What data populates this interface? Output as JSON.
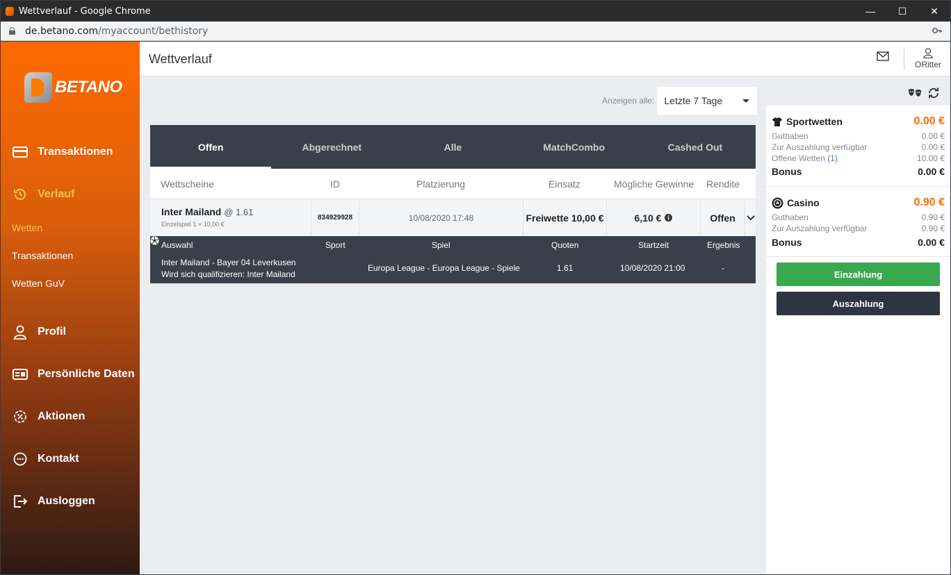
{
  "window": {
    "title": "Wettverlauf - Google Chrome",
    "url_host": "de.betano.com",
    "url_path": "/myaccount/bethistory"
  },
  "brand": {
    "name": "BETANO",
    "accent": "#ff6a00"
  },
  "sidebar": {
    "items": [
      {
        "label": "Transaktionen",
        "icon": "card-icon"
      },
      {
        "label": "Verlauf",
        "icon": "history-icon"
      },
      {
        "label": "Profil",
        "icon": "user-icon"
      },
      {
        "label": "Persönliche Daten",
        "icon": "id-card-icon"
      },
      {
        "label": "Aktionen",
        "icon": "percent-gear-icon"
      },
      {
        "label": "Kontakt",
        "icon": "chat-icon"
      },
      {
        "label": "Ausloggen",
        "icon": "logout-icon"
      }
    ],
    "subitems": [
      "Wetten",
      "Transaktionen",
      "Wetten GuV"
    ]
  },
  "header": {
    "title": "Wettverlauf",
    "username": "ORitter"
  },
  "filter": {
    "label": "Anzeigen alle:",
    "selected": "Letzte 7 Tage"
  },
  "tabs": [
    "Offen",
    "Abgerechnet",
    "Alle",
    "MatchCombo",
    "Cashed Out"
  ],
  "table": {
    "headers": [
      "Wettscheine",
      "ID",
      "Platzierung",
      "Einsatz",
      "Mögliche Gewinne",
      "Rendite"
    ],
    "bet": {
      "team": "Inter Mailand",
      "odds": "@ 1.61",
      "sub": "Einzelspiel 1 × 10,00 €",
      "id": "834929928",
      "placed": "10/08/2020 17:48",
      "stake": "Freiwette 10,00 €",
      "win": "6,10 €",
      "status": "Offen"
    },
    "detail_headers": [
      "Auswahl",
      "Sport",
      "Spiel",
      "Quoten",
      "Startzeit",
      "Ergebnis"
    ],
    "detail": {
      "match": "Inter Mailand - Bayer 04 Leverkusen",
      "pick": "Wird sich qualifizieren: Inter Mailand",
      "game": "Europa League - Europa League - Spiele",
      "odds": "1.61",
      "start": "10/08/2020 21:00",
      "result": "-"
    }
  },
  "wallet": {
    "sport": {
      "title": "Sportwetten",
      "amount": "0.00 €",
      "rows": [
        {
          "label": "Guthaben",
          "value": "0.00 €"
        },
        {
          "label": "Zur Auszahlung verfügbar",
          "value": "0.00 €"
        },
        {
          "label": "Offene Wetten",
          "count": "(1)",
          "value": "10.00 €"
        }
      ],
      "bonus_label": "Bonus",
      "bonus": "0.00 €"
    },
    "casino": {
      "title": "Casino",
      "amount": "0.90 €",
      "rows": [
        {
          "label": "Guthaben",
          "value": "0.90 €"
        },
        {
          "label": "Zur Auszahlung verfügbar",
          "value": "0.90 €"
        }
      ],
      "bonus_label": "Bonus",
      "bonus": "0.00 €"
    },
    "deposit": "Einzahlung",
    "withdraw": "Auszahlung"
  }
}
